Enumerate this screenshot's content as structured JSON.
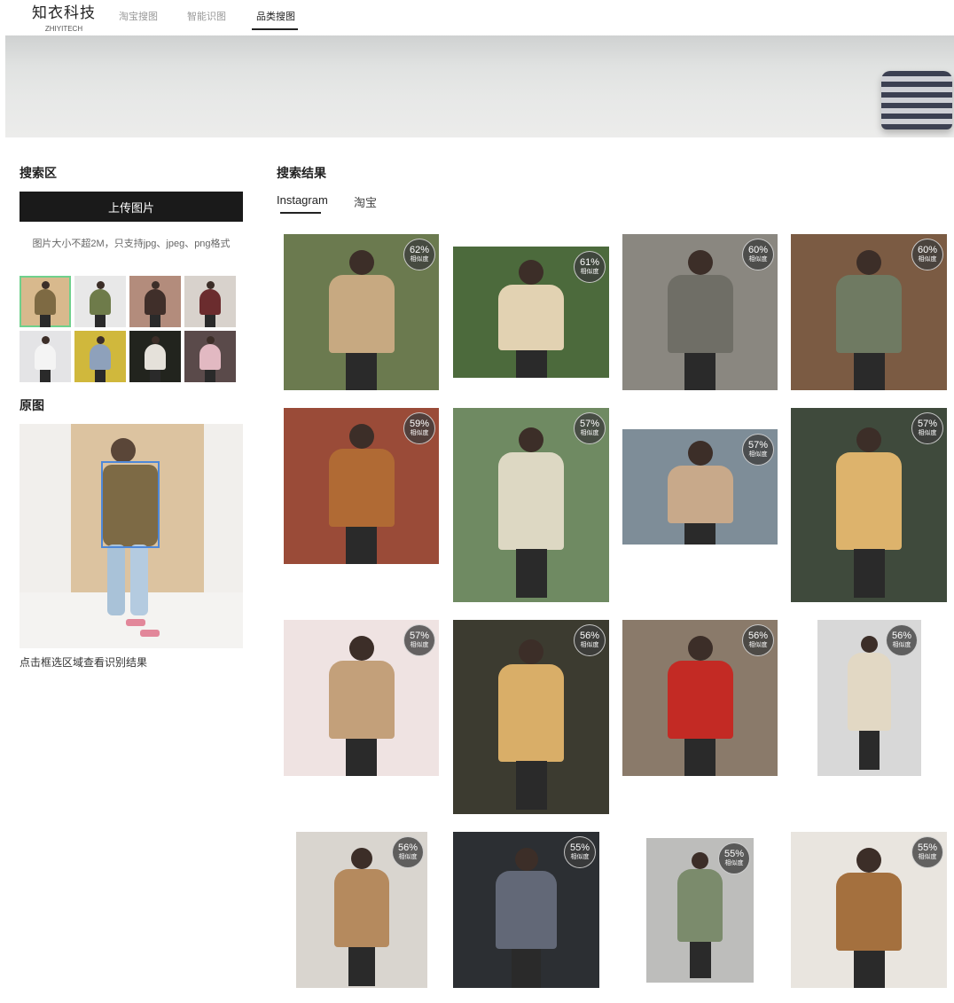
{
  "header": {
    "logo_main": "知衣科技",
    "logo_sub": "ZHIYITECH",
    "nav": [
      "淘宝搜图",
      "智能识图",
      "品类搜图"
    ],
    "active_nav": "品类搜图"
  },
  "search": {
    "title": "搜索区",
    "upload_label": "上传图片",
    "hint": "图片大小不超2M，只支持jpg、jpeg、png格式"
  },
  "original": {
    "title": "原图",
    "caption": "点击框选区域查看识别结果"
  },
  "results": {
    "title": "搜索结果",
    "tabs": [
      "Instagram",
      "淘宝"
    ],
    "active_tab": "Instagram",
    "similarity_label": "相似度",
    "items": [
      {
        "pct": "62%",
        "coat": "#c7a981",
        "bg": "#6b7a4f"
      },
      {
        "pct": "61%",
        "coat": "#e2d2b2",
        "bg": "#4c6a3c"
      },
      {
        "pct": "60%",
        "coat": "#6f6e66",
        "bg": "#8a8780"
      },
      {
        "pct": "60%",
        "coat": "#6f7a62",
        "bg": "#7b5b43"
      },
      {
        "pct": "59%",
        "coat": "#b06a34",
        "bg": "#9a4b38"
      },
      {
        "pct": "57%",
        "coat": "#ddd8c3",
        "bg": "#6f8a62"
      },
      {
        "pct": "57%",
        "coat": "#c8a98a",
        "bg": "#7e8d98"
      },
      {
        "pct": "57%",
        "coat": "#ddb36c",
        "bg": "#3f4a3c"
      },
      {
        "pct": "57%",
        "coat": "#c3a07a",
        "bg": "#efe3e2"
      },
      {
        "pct": "56%",
        "coat": "#d9ae68",
        "bg": "#3c3b30"
      },
      {
        "pct": "56%",
        "coat": "#c32a24",
        "bg": "#8a7a6a"
      },
      {
        "pct": "56%",
        "coat": "#e2d8c4",
        "bg": "#d8d8d8"
      },
      {
        "pct": "56%",
        "coat": "#b58a5e",
        "bg": "#d9d5cf"
      },
      {
        "pct": "55%",
        "coat": "#626877",
        "bg": "#2c2f33"
      },
      {
        "pct": "55%",
        "coat": "#7b8b6c",
        "bg": "#bdbdbb"
      },
      {
        "pct": "55%",
        "coat": "#a4703e",
        "bg": "#e9e5df"
      }
    ]
  },
  "thumbnails": [
    {
      "coat": "#7e6a43",
      "bg": "#d8b98d",
      "selected": true
    },
    {
      "coat": "#6e7b4a",
      "bg": "#e8e8e8",
      "selected": false
    },
    {
      "coat": "#402f2a",
      "bg": "#b38c7c",
      "selected": false
    },
    {
      "coat": "#6b2c2e",
      "bg": "#d8d2cc",
      "selected": false
    },
    {
      "coat": "#f4f4f4",
      "bg": "#e4e4e6",
      "selected": false
    },
    {
      "coat": "#8ea1bb",
      "bg": "#d0b83c",
      "selected": false
    },
    {
      "coat": "#e5e1da",
      "bg": "#22241e",
      "selected": false
    },
    {
      "coat": "#e2b9c2",
      "bg": "#5a4a4a",
      "selected": false
    }
  ]
}
